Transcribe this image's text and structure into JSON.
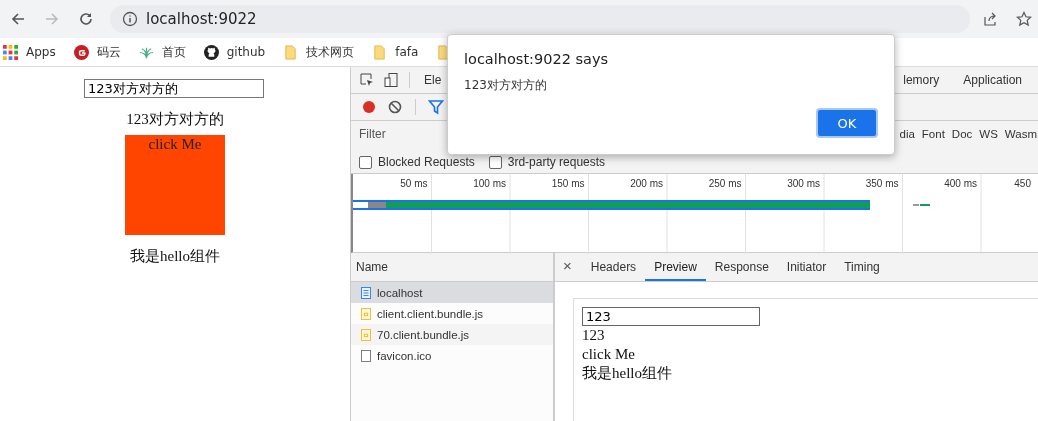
{
  "browser": {
    "url": "localhost:9022"
  },
  "bookmarks": [
    {
      "label": "Apps",
      "kind": "apps"
    },
    {
      "label": "码云",
      "kind": "gitee"
    },
    {
      "label": "首页",
      "kind": "leaf"
    },
    {
      "label": "github",
      "kind": "github"
    },
    {
      "label": "技术网页",
      "kind": "folder"
    },
    {
      "label": "fafa",
      "kind": "folder"
    },
    {
      "kind": "folder"
    }
  ],
  "page": {
    "input_value": "123对方对方的",
    "echo": "123对方对方的",
    "box_label": "click Me",
    "footer": "我是hello组件"
  },
  "devtools": {
    "tabs": [
      {
        "label": "Ele",
        "selected": false
      },
      {
        "label": "lemory",
        "selected": false
      },
      {
        "label": "Application",
        "selected": false
      }
    ],
    "filter": {
      "placeholder": "Filter"
    },
    "types": [
      "dia",
      "Font",
      "Doc",
      "WS",
      "Wasm"
    ],
    "checkboxes": [
      {
        "label": "Blocked Requests",
        "checked": false
      },
      {
        "label": "3rd-party requests",
        "checked": false
      }
    ],
    "timeline_ticks": [
      "50 ms",
      "100 ms",
      "150 ms",
      "200 ms",
      "250 ms",
      "300 ms",
      "350 ms",
      "400 ms",
      "450"
    ],
    "name_header": "Name",
    "requests": [
      {
        "name": "localhost",
        "kind": "doc",
        "selected": true
      },
      {
        "name": "client.client.bundle.js",
        "kind": "script",
        "selected": false
      },
      {
        "name": "70.client.bundle.js",
        "kind": "script",
        "selected": false
      },
      {
        "name": "favicon.ico",
        "kind": "other",
        "selected": false
      }
    ],
    "detail_close": "×",
    "detail_tabs": [
      {
        "label": "Headers",
        "selected": false
      },
      {
        "label": "Preview",
        "selected": true
      },
      {
        "label": "Response",
        "selected": false
      },
      {
        "label": "Initiator",
        "selected": false
      },
      {
        "label": "Timing",
        "selected": false
      }
    ],
    "preview": {
      "input_value": "123",
      "lines": [
        "123",
        "click Me",
        "我是hello组件"
      ]
    }
  },
  "dialog": {
    "title": "localhost:9022 says",
    "message": "123对方对方的",
    "button": "OK"
  }
}
